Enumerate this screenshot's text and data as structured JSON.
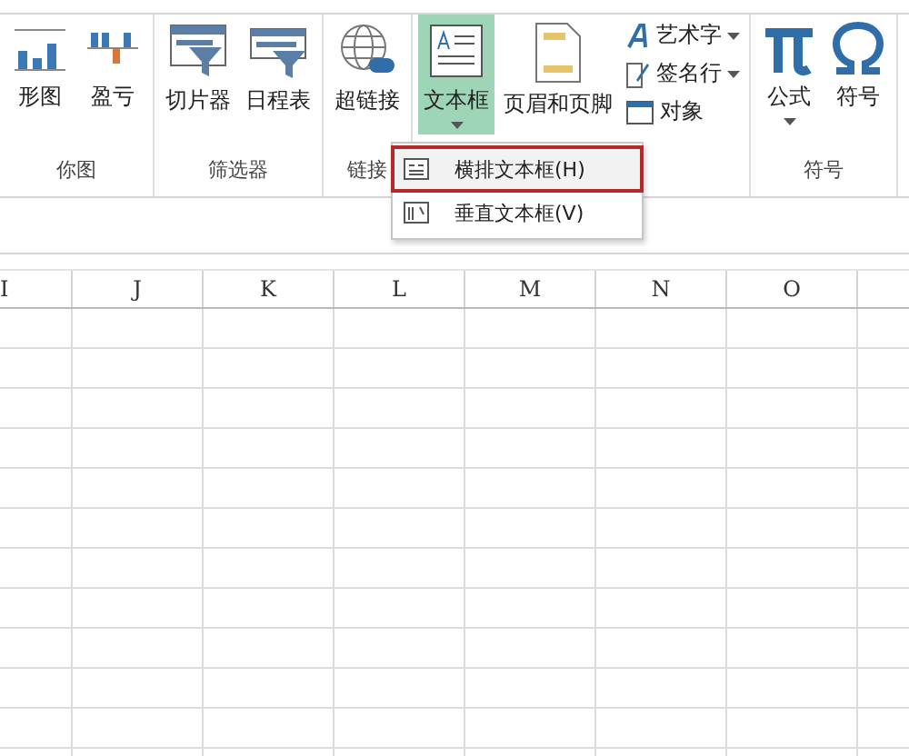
{
  "ribbon": {
    "groups": [
      {
        "label": "你图",
        "buttons": [
          {
            "label": "形图",
            "kind": "large",
            "selected": false,
            "dropdown": false
          },
          {
            "label": "盈亏",
            "kind": "large",
            "selected": false,
            "dropdown": false
          }
        ]
      },
      {
        "label": "筛选器",
        "buttons": [
          {
            "label": "切片器",
            "kind": "large",
            "selected": false,
            "dropdown": false
          },
          {
            "label": "日程表",
            "kind": "large",
            "selected": false,
            "dropdown": false
          }
        ]
      },
      {
        "label": "链接",
        "buttons": [
          {
            "label": "超链接",
            "kind": "large",
            "selected": false,
            "dropdown": false
          }
        ]
      },
      {
        "buttons": [
          {
            "label": "文本框",
            "kind": "large",
            "selected": true,
            "dropdown": true
          },
          {
            "label": "页眉和页脚",
            "kind": "large",
            "selected": false,
            "dropdown": false
          },
          {
            "label": "艺术字",
            "kind": "small",
            "selected": false,
            "dropdown": true
          },
          {
            "label": "签名行",
            "kind": "small",
            "selected": false,
            "dropdown": true
          },
          {
            "label": "对象",
            "kind": "small",
            "selected": false,
            "dropdown": false
          }
        ]
      },
      {
        "label": "符号",
        "buttons": [
          {
            "label": "公式",
            "kind": "large",
            "selected": false,
            "dropdown": true
          },
          {
            "label": "符号",
            "kind": "large",
            "selected": false,
            "dropdown": false
          }
        ]
      }
    ]
  },
  "menu": {
    "items": [
      {
        "label": "横排文本框(H)",
        "selected": true
      },
      {
        "label": "垂直文本框(V)",
        "selected": false
      }
    ]
  },
  "columns": [
    "I",
    "J",
    "K",
    "L",
    "M",
    "N",
    "O"
  ]
}
